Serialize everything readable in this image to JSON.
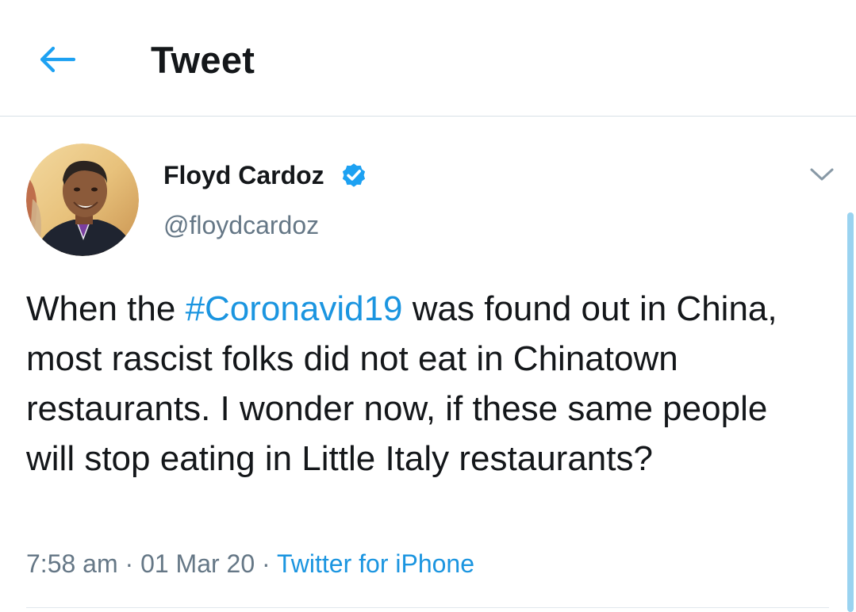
{
  "header": {
    "title": "Tweet"
  },
  "author": {
    "name": "Floyd Cardoz",
    "handle": "@floydcardoz",
    "verified": true
  },
  "tweet": {
    "text_before": "When the ",
    "hashtag": "#Coronavid19",
    "text_after": " was found out in China, most rascist folks did not eat in Chinatown restaurants. I wonder now, if these same people will stop eating in Little Italy restaurants?"
  },
  "meta": {
    "time": "7:58 am",
    "separator": " · ",
    "date": "01 Mar 20",
    "source": "Twitter for iPhone"
  },
  "icons": {
    "back": "arrow-left-icon",
    "verified": "verified-badge-icon",
    "more": "chevron-down-icon"
  },
  "colors": {
    "accent": "#1b95e0",
    "text": "#14171a",
    "secondary": "#657786",
    "divider": "#d8e0e6"
  }
}
